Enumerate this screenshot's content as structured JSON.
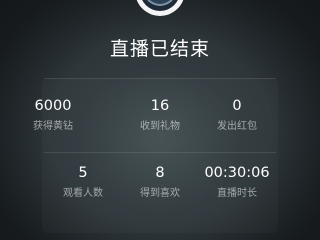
{
  "title": "直播已结束",
  "stats": [
    {
      "value": "6000",
      "label": "获得黄钻"
    },
    {
      "value": "16",
      "label": "收到礼物"
    },
    {
      "value": "0",
      "label": "发出红包"
    },
    {
      "value": "5",
      "label": "观看人数"
    },
    {
      "value": "8",
      "label": "得到喜欢"
    },
    {
      "value": "00:30:06",
      "label": "直播时长"
    }
  ]
}
